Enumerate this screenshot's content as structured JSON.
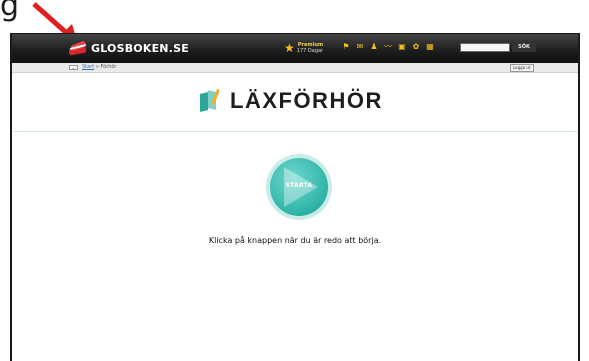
{
  "outer": {
    "caption_fragment": "g"
  },
  "topbar": {
    "logo_text": "GLOSBOKEN.SE",
    "premium_label": "Premium",
    "premium_days": "177 Dagar",
    "search_value": "",
    "search_button": "SÖK"
  },
  "crumbbar": {
    "back": "«",
    "home": "Start",
    "separator": "»",
    "current": "Förhör",
    "logout": "Logga ut"
  },
  "page": {
    "title": "LÄXFÖRHÖR",
    "start_button": "STARTA",
    "instruction": "Klicka på knappen när du är redo att börja."
  },
  "colors": {
    "teal": "#2eb3a6",
    "dark_bar": "#1c1c1c",
    "star": "#f2c21b",
    "arrow": "#e02020"
  },
  "icons": [
    "star-icon",
    "flag-icon",
    "mail-icon",
    "person-icon",
    "chart-icon",
    "folder-icon",
    "gear-icon",
    "grid-icon"
  ]
}
